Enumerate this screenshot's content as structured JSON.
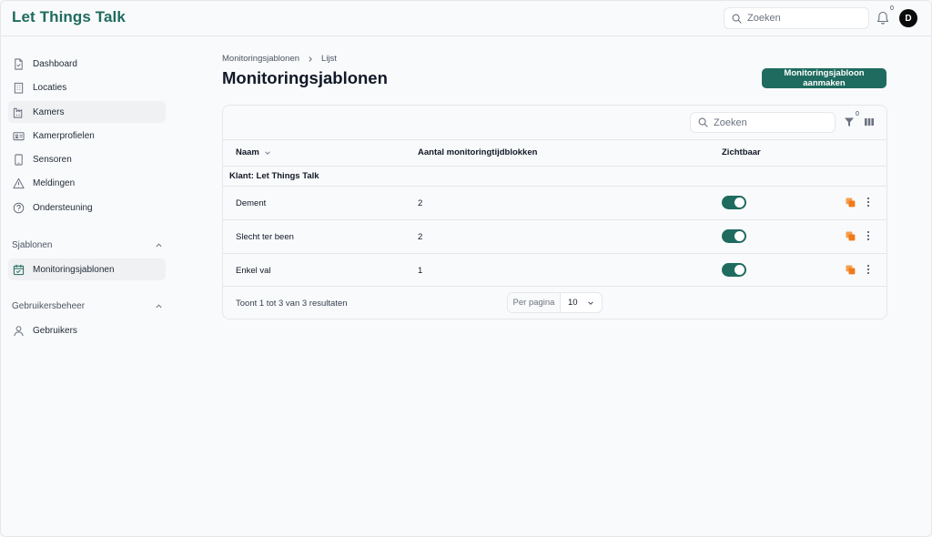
{
  "app": {
    "logo": "Let Things Talk"
  },
  "header": {
    "search_placeholder": "Zoeken",
    "notification_count": "0",
    "avatar_initial": "D"
  },
  "sidebar": {
    "items": [
      {
        "label": "Dashboard",
        "icon": "document-icon"
      },
      {
        "label": "Locaties",
        "icon": "building-icon"
      },
      {
        "label": "Kamers",
        "icon": "room-icon",
        "active": true
      },
      {
        "label": "Kamerprofielen",
        "icon": "id-card-icon"
      },
      {
        "label": "Sensoren",
        "icon": "tablet-icon"
      },
      {
        "label": "Meldingen",
        "icon": "warning-icon"
      },
      {
        "label": "Ondersteuning",
        "icon": "help-icon"
      }
    ],
    "sections": [
      {
        "label": "Sjablonen",
        "items": [
          {
            "label": "Monitoringsjablonen",
            "icon": "calendar-icon",
            "active": true
          }
        ]
      },
      {
        "label": "Gebruikersbeheer",
        "items": [
          {
            "label": "Gebruikers",
            "icon": "user-icon"
          }
        ]
      }
    ]
  },
  "breadcrumb": {
    "parent": "Monitoringsjablonen",
    "current": "Lijst"
  },
  "page": {
    "title": "Monitoringsjablonen",
    "create_button": "Monitoringsjabloon aanmaken"
  },
  "table": {
    "search_placeholder": "Zoeken",
    "filter_count": "0",
    "columns": {
      "name": "Naam",
      "blocks": "Aantal monitoringtijdblokken",
      "visible": "Zichtbaar"
    },
    "group_label": "Klant: Let Things Talk",
    "rows": [
      {
        "name": "Dement",
        "blocks": "2",
        "visible": true
      },
      {
        "name": "Slecht ter been",
        "blocks": "2",
        "visible": true
      },
      {
        "name": "Enkel val",
        "blocks": "1",
        "visible": true
      }
    ],
    "footer": {
      "summary": "Toont 1 tot 3 van 3 resultaten",
      "per_page_label": "Per pagina",
      "per_page_value": "10"
    }
  },
  "colors": {
    "brand": "#1f6b5f",
    "action_orange": "#f07a1a"
  }
}
